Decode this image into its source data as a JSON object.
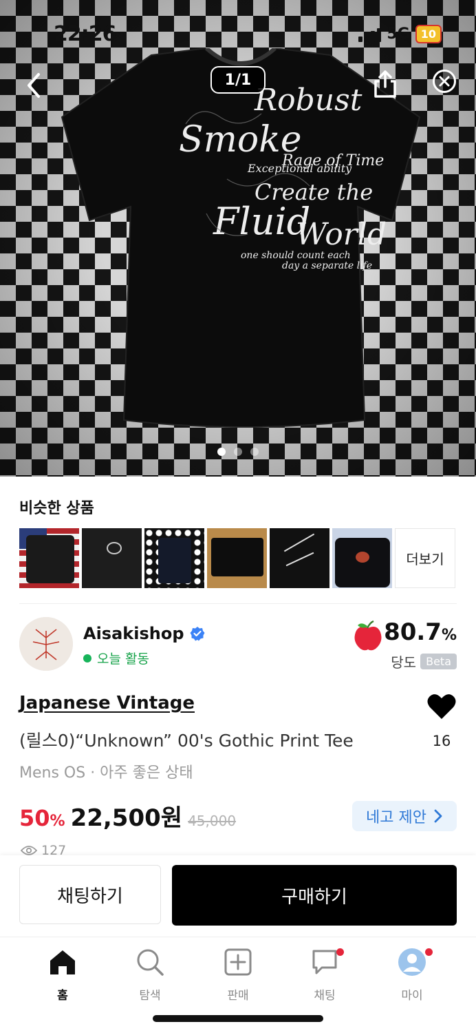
{
  "status_bar": {
    "time": "22:26",
    "network": "5G",
    "battery": "10"
  },
  "gallery": {
    "counter": "1/1",
    "active_index": 1,
    "dot_count": 3
  },
  "similar": {
    "title": "비슷한 상품",
    "more_label": "더보기",
    "thumbnail_count": 6
  },
  "seller": {
    "name": "Aisakishop",
    "activity": "오늘 활동",
    "score": "80.7",
    "score_unit": "%",
    "sugar_label": "당도",
    "beta_label": "Beta"
  },
  "product": {
    "brand": "Japanese Vintage",
    "title": "(릴스0)“Unknown” 00's Gothic Print Tee",
    "likes": "16",
    "meta": "Mens OS · 아주 좋은 상태",
    "discount": "50",
    "discount_unit": "%",
    "price": "22,500원",
    "original_price": "45,000",
    "offer_label": "네고 제안",
    "views": "127"
  },
  "actions": {
    "chat_label": "채팅하기",
    "buy_label": "구매하기"
  },
  "tabs": [
    {
      "label": "홈"
    },
    {
      "label": "탐색"
    },
    {
      "label": "판매"
    },
    {
      "label": "채팅"
    },
    {
      "label": "마이"
    }
  ],
  "colors": {
    "accent_red": "#e5253a",
    "offer_blue": "#2e78d6",
    "active_green": "#17a34a"
  }
}
